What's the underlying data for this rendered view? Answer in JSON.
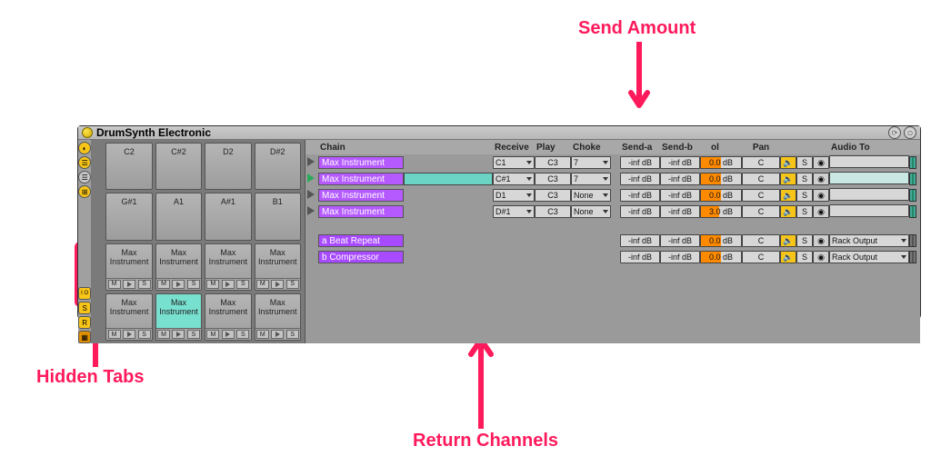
{
  "annotations": {
    "send_amount": "Send Amount",
    "hidden_tabs": "Hidden Tabs",
    "return_channels": "Return Channels"
  },
  "titlebar": {
    "title": "DrumSynth Electronic"
  },
  "side_labels": {
    "io": "I O",
    "s": "S",
    "r": "R"
  },
  "pads": {
    "row0": [
      "C2",
      "C#2",
      "D2",
      "D#2"
    ],
    "row1": [
      "G#1",
      "A1",
      "A#1",
      "B1"
    ],
    "inst_label": "Max Instrument",
    "mini_m": "M",
    "mini_s": "S"
  },
  "headers": {
    "chain": "Chain",
    "receive": "Receive",
    "play": "Play",
    "choke": "Choke",
    "send_a": "Send-a",
    "send_b": "Send-b",
    "vol": "ol",
    "pan": "Pan",
    "audio_to": "Audio To"
  },
  "chains": [
    {
      "name": "Max Instrument",
      "recv": "C1",
      "play": "C3",
      "choke": "7",
      "sa": "-inf dB",
      "sb": "-inf dB",
      "vol": "0.0 dB",
      "pan": "C",
      "out": "",
      "play_on": false
    },
    {
      "name": "Max Instrument",
      "recv": "C#1",
      "play": "C3",
      "choke": "7",
      "sa": "-inf dB",
      "sb": "-inf dB",
      "vol": "0.0 dB",
      "pan": "C",
      "out": "",
      "play_on": true
    },
    {
      "name": "Max Instrument",
      "recv": "D1",
      "play": "C3",
      "choke": "None",
      "sa": "-inf dB",
      "sb": "-inf dB",
      "vol": "0.0 dB",
      "pan": "C",
      "out": "",
      "play_on": false
    },
    {
      "name": "Max Instrument",
      "recv": "D#1",
      "play": "C3",
      "choke": "None",
      "sa": "-inf dB",
      "sb": "-inf dB",
      "vol": "3.0 dB",
      "pan": "C",
      "out": "",
      "play_on": false
    }
  ],
  "returns": [
    {
      "name": "a Beat Repeat",
      "sa": "-inf dB",
      "sb": "-inf dB",
      "vol": "0.0 dB",
      "pan": "C",
      "out": "Rack Output"
    },
    {
      "name": "b Compressor",
      "sa": "-inf dB",
      "sb": "-inf dB",
      "vol": "0.0 dB",
      "pan": "C",
      "out": "Rack Output"
    }
  ],
  "icons": {
    "spk": "🔈",
    "solo": "S",
    "pv": "◉"
  }
}
